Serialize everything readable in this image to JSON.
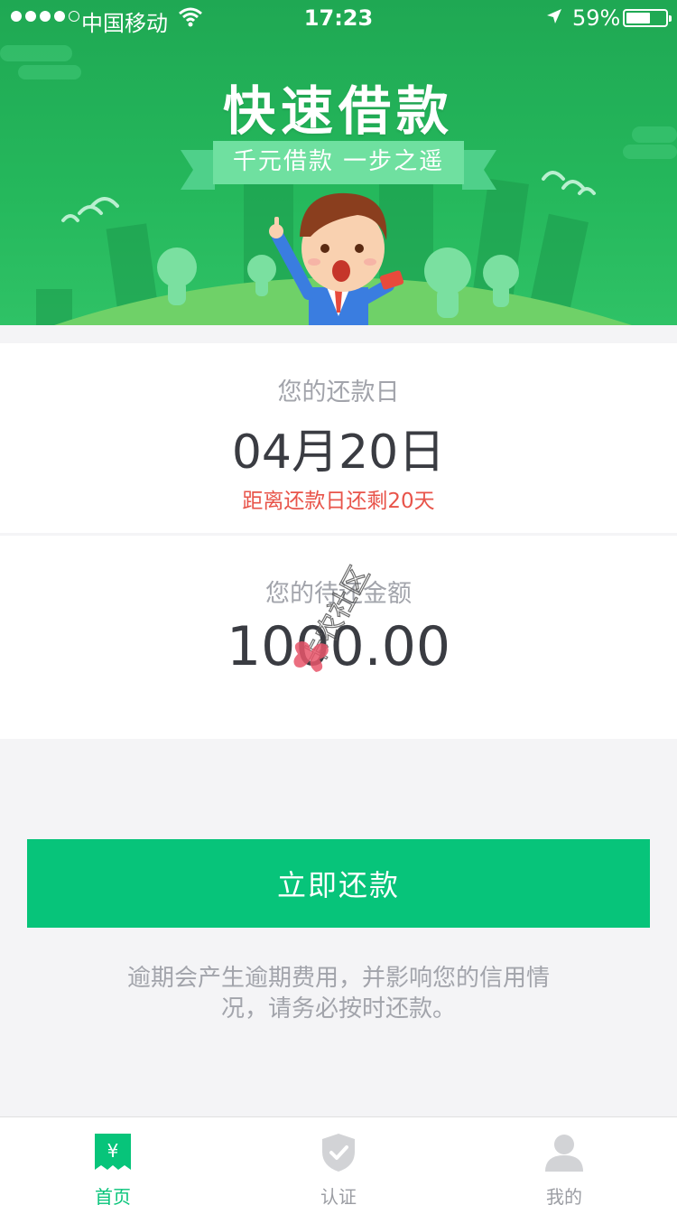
{
  "status_bar": {
    "carrier": "中国移动",
    "time": "17:23",
    "battery": "59%",
    "battery_level": 0.59,
    "signal_bars": 4
  },
  "banner": {
    "title": "快速借款",
    "ribbon": "千元借款  一步之遥",
    "coin_text": "¥"
  },
  "due_date": {
    "label": "您的还款日",
    "value": "04月20日",
    "remaining": "距离还款日还剩20天"
  },
  "amount": {
    "label": "您的待还金额",
    "value": "1000.00"
  },
  "watermark": "卡农社区",
  "action": {
    "repay_label": "立即还款",
    "notice": "逾期会产生逾期费用，并影响您的信用情况，请务必按时还款。"
  },
  "tabs": [
    {
      "label": "首页",
      "icon": "yen-wallet-icon",
      "active": true
    },
    {
      "label": "认证",
      "icon": "shield-check-icon",
      "active": false
    },
    {
      "label": "我的",
      "icon": "person-icon",
      "active": false
    }
  ],
  "colors": {
    "primary": "#07c47a",
    "banner_green": "#22b25a",
    "warning": "#e8544a",
    "text_muted": "#a2a4ab",
    "text_main": "#3a3c42"
  }
}
